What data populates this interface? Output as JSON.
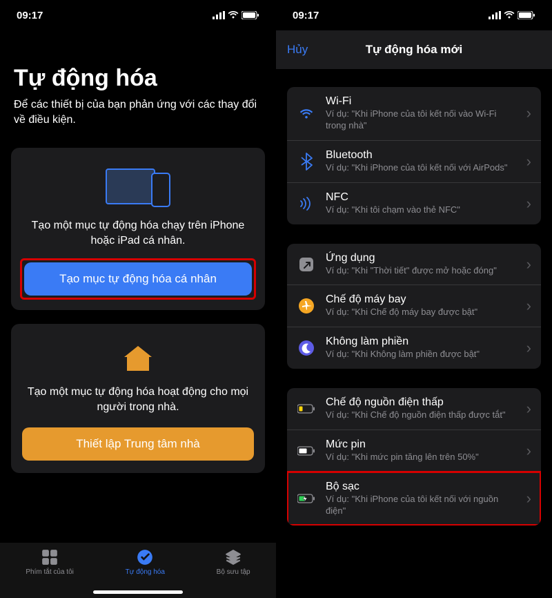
{
  "status": {
    "time": "09:17"
  },
  "left": {
    "title": "Tự động hóa",
    "subtitle": "Để các thiết bị của bạn phản ứng với các thay đổi về điều kiện.",
    "card1": {
      "desc": "Tạo một mục tự động hóa chạy trên iPhone hoặc iPad cá nhân.",
      "button": "Tạo mục tự động hóa cá nhân"
    },
    "card2": {
      "desc": "Tạo một mục tự động hóa hoạt động cho mọi người trong nhà.",
      "button": "Thiết lập Trung tâm nhà"
    },
    "tabs": {
      "shortcuts": "Phím tắt của tôi",
      "automation": "Tự động hóa",
      "gallery": "Bộ sưu tập"
    }
  },
  "right": {
    "cancel": "Hủy",
    "title": "Tự động hóa mới",
    "group1": [
      {
        "title": "Wi-Fi",
        "sub": "Ví dụ: \"Khi iPhone của tôi kết nối vào Wi-Fi trong nhà\""
      },
      {
        "title": "Bluetooth",
        "sub": "Ví dụ: \"Khi iPhone của tôi kết nối với AirPods\""
      },
      {
        "title": "NFC",
        "sub": "Ví dụ: \"Khi tôi chạm vào thẻ NFC\""
      }
    ],
    "group2": [
      {
        "title": "Ứng dụng",
        "sub": "Ví dụ: \"Khi \"Thời tiết\" được mở hoặc đóng\""
      },
      {
        "title": "Chế độ máy bay",
        "sub": "Ví dụ: \"Khi Chế độ máy bay được bật\""
      },
      {
        "title": "Không làm phiền",
        "sub": "Ví dụ: \"Khi Không làm phiền được bật\""
      }
    ],
    "group3": [
      {
        "title": "Chế độ nguồn điện thấp",
        "sub": "Ví dụ: \"Khi Chế độ nguồn điện thấp được tắt\""
      },
      {
        "title": "Mức pin",
        "sub": "Ví dụ: \"Khi mức pin tăng lên trên 50%\""
      },
      {
        "title": "Bộ sạc",
        "sub": "Ví dụ: \"Khi iPhone của tôi kết nối với nguồn điện\""
      }
    ]
  }
}
